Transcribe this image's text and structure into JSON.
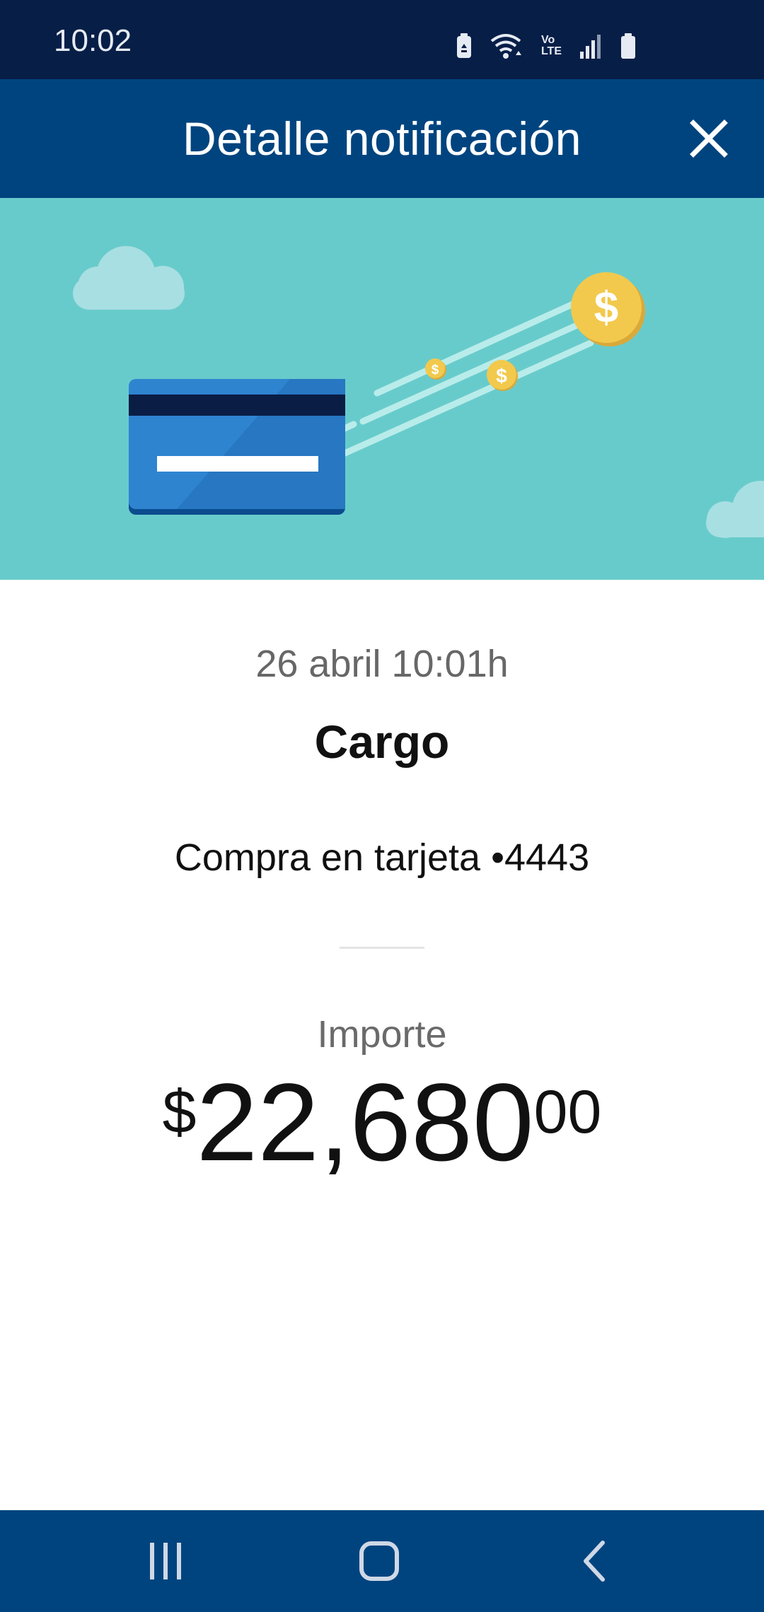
{
  "status_bar": {
    "time": "10:02",
    "icons": [
      "battery-saver-icon",
      "wifi-icon",
      "volte-icon",
      "signal-icon",
      "battery-icon"
    ],
    "volte_top": "Vo",
    "volte_bottom": "LTE"
  },
  "header": {
    "title": "Detalle notificación",
    "close_icon": "close-icon"
  },
  "hero": {
    "illustration": "credit-card-coins-illustration",
    "coin_symbol": "$",
    "colors": {
      "background": "#68cbcb",
      "card": "#2f84d0",
      "coin": "#f2c94c"
    }
  },
  "notification": {
    "datetime": "26 abril 10:01h",
    "type": "Cargo",
    "description": "Compra en tarjeta •4443",
    "amount_label": "Importe",
    "amount_currency": "$",
    "amount_main": "22,680",
    "amount_cents": "00"
  },
  "nav_bar": {
    "items": [
      "recent-apps-icon",
      "home-icon",
      "back-icon"
    ]
  },
  "colors": {
    "status_bar": "#071e47",
    "header": "#00447f",
    "nav_bar": "#00447f"
  }
}
